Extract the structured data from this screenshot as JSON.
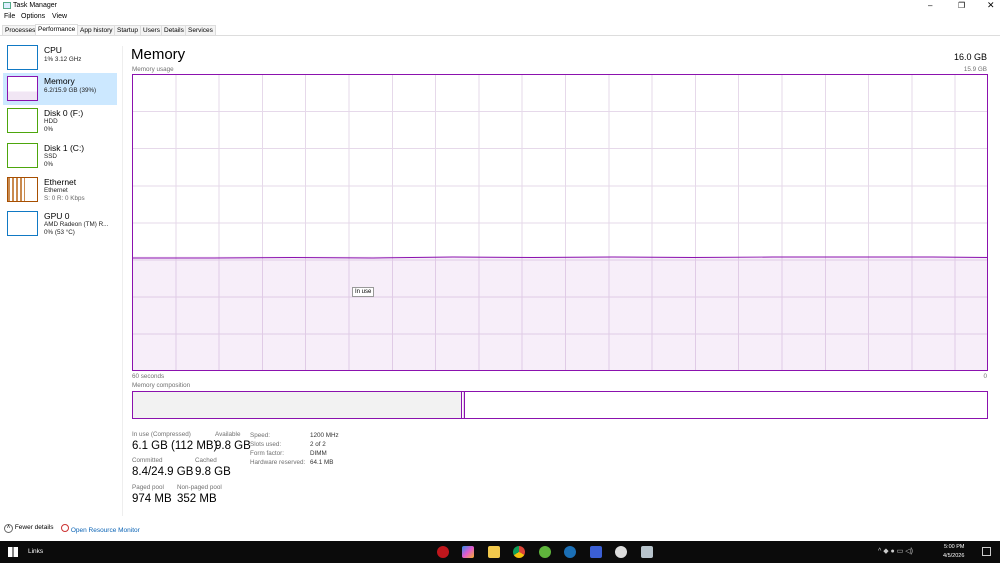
{
  "window": {
    "title": "Task Manager"
  },
  "menu": [
    "File",
    "Options",
    "View"
  ],
  "tabs": [
    "Processes",
    "Performance",
    "App history",
    "Startup",
    "Users",
    "Details",
    "Services"
  ],
  "sidebar": [
    {
      "name": "CPU",
      "line1": "1% 3.12 GHz",
      "color": "#1179c4"
    },
    {
      "name": "Memory",
      "line1": "6.2/15.9 GB (39%)",
      "color": "#8b12ae"
    },
    {
      "name": "Disk 0 (F:)",
      "line1": "HDD",
      "line2": "0%",
      "color": "#4da60c"
    },
    {
      "name": "Disk 1 (C:)",
      "line1": "SSD",
      "line2": "0%",
      "color": "#4da60c"
    },
    {
      "name": "Ethernet",
      "line1": "Ethernet",
      "line2": "S: 0 R: 0 Kbps",
      "color": "#a74f01"
    },
    {
      "name": "GPU 0",
      "line1": "AMD Radeon (TM) R...",
      "line2": "0% (53 °C)",
      "color": "#1179c4"
    }
  ],
  "main": {
    "title": "Memory",
    "total": "16.0 GB",
    "usage_label": "Memory usage",
    "max_label": "15.9 GB",
    "tooltip": "In use",
    "time_left": "60 seconds",
    "time_right": "0",
    "composition_label": "Memory composition",
    "in_use_fraction": 0.39,
    "stats": {
      "in_use_label": "In use (Compressed)",
      "in_use": "6.1 GB (112 MB)",
      "available_label": "Available",
      "available": "9.8 GB",
      "committed_label": "Committed",
      "committed": "8.4/24.9 GB",
      "cached_label": "Cached",
      "cached": "9.8 GB",
      "paged_label": "Paged pool",
      "paged": "974 MB",
      "nonpaged_label": "Non-paged pool",
      "nonpaged": "352 MB"
    },
    "details": [
      {
        "k": "Speed:",
        "v": "1200 MHz"
      },
      {
        "k": "Slots used:",
        "v": "2 of 2"
      },
      {
        "k": "Form factor:",
        "v": "DIMM"
      },
      {
        "k": "Hardware reserved:",
        "v": "64.1 MB"
      }
    ]
  },
  "footer": {
    "fewer": "Fewer details",
    "monitor": "Open Resource Monitor"
  },
  "taskbar": {
    "links": "Links",
    "time": "5:00 PM",
    "date": "4/5/2026"
  },
  "accent": "#8b12ae"
}
